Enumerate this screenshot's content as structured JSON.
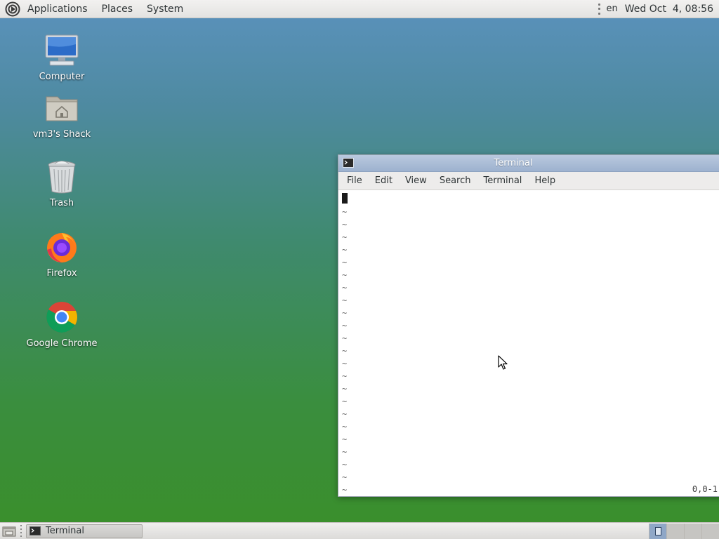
{
  "top_panel": {
    "menus": [
      "Applications",
      "Places",
      "System"
    ],
    "language": "en",
    "clock": "Wed Oct  4, 08:56"
  },
  "desktop_icons": [
    {
      "label": "Computer",
      "icon": "computer-icon"
    },
    {
      "label": "vm3's Shack",
      "icon": "home-folder-icon"
    },
    {
      "label": "Trash",
      "icon": "trash-icon"
    },
    {
      "label": "Firefox",
      "icon": "firefox-icon"
    },
    {
      "label": "Google Chrome",
      "icon": "chrome-icon"
    }
  ],
  "terminal": {
    "title": "Terminal",
    "menus": [
      "File",
      "Edit",
      "View",
      "Search",
      "Terminal",
      "Help"
    ],
    "tilde": "~",
    "ruler": "0,0-1"
  },
  "taskbar": {
    "tasks": [
      {
        "label": "Terminal",
        "icon": "terminal-icon"
      }
    ],
    "workspace_count": 4,
    "active_workspace": 1
  },
  "colors": {
    "titlebar": "#9db2cf",
    "desktop_top": "#5b92bd",
    "desktop_bottom": "#3a8f2a"
  }
}
